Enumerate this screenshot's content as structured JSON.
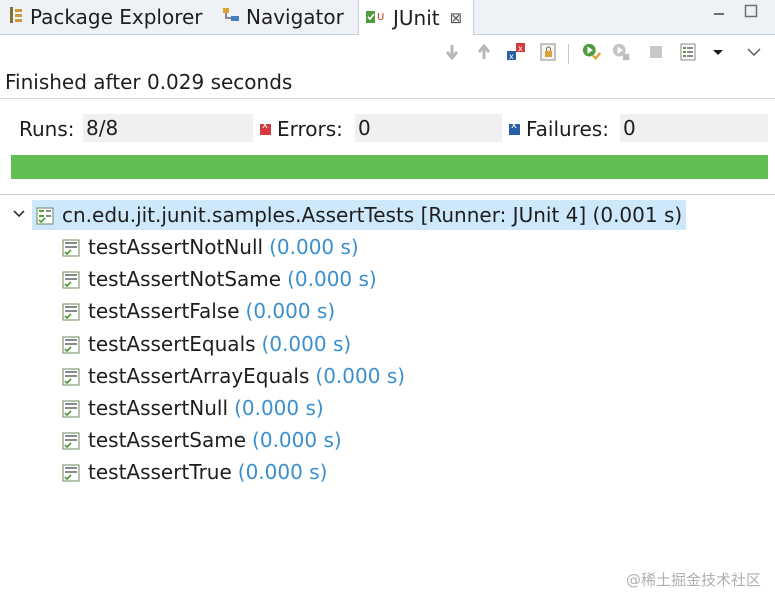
{
  "tabs": [
    {
      "label": "Package Explorer",
      "icon": "package-explorer-icon"
    },
    {
      "label": "Navigator",
      "icon": "navigator-icon"
    },
    {
      "label": "JUnit",
      "icon": "junit-icon",
      "active": true
    }
  ],
  "window_buttons": {
    "minimize": "minimize-icon",
    "maximize": "maximize-icon"
  },
  "toolbar": {
    "buttons": [
      "next-failure-icon",
      "previous-failure-icon",
      "show-failures-only-icon",
      "scroll-lock-icon",
      "rerun-test-icon",
      "rerun-failed-first-icon",
      "stop-icon",
      "test-run-history-icon",
      "dropdown-arrow-icon",
      "view-menu-icon"
    ]
  },
  "status": {
    "text": "Finished after 0.029 seconds"
  },
  "counters": {
    "runs_label": "Runs:",
    "runs_value": "8/8",
    "errors_label": "Errors:",
    "errors_value": "0",
    "failures_label": "Failures:",
    "failures_value": "0"
  },
  "progress": {
    "fraction": 1.0,
    "color": "#5fbf52"
  },
  "tree": {
    "root": {
      "name": "cn.edu.jit.junit.samples.AssertTests [Runner: JUnit 4] (0.001 s)"
    },
    "items": [
      {
        "name": "testAssertNotNull",
        "time": "(0.000 s)"
      },
      {
        "name": "testAssertNotSame",
        "time": "(0.000 s)"
      },
      {
        "name": "testAssertFalse",
        "time": "(0.000 s)"
      },
      {
        "name": "testAssertEquals",
        "time": "(0.000 s)"
      },
      {
        "name": "testAssertArrayEquals",
        "time": "(0.000 s)"
      },
      {
        "name": "testAssertNull",
        "time": "(0.000 s)"
      },
      {
        "name": "testAssertSame",
        "time": "(0.000 s)"
      },
      {
        "name": "testAssertTrue",
        "time": "(0.000 s)"
      }
    ]
  },
  "watermark": "@稀土掘金技术社区",
  "colors": {
    "time": "#3b8fcf",
    "selection": "#cde8fb",
    "pass": "#5fbf52"
  }
}
